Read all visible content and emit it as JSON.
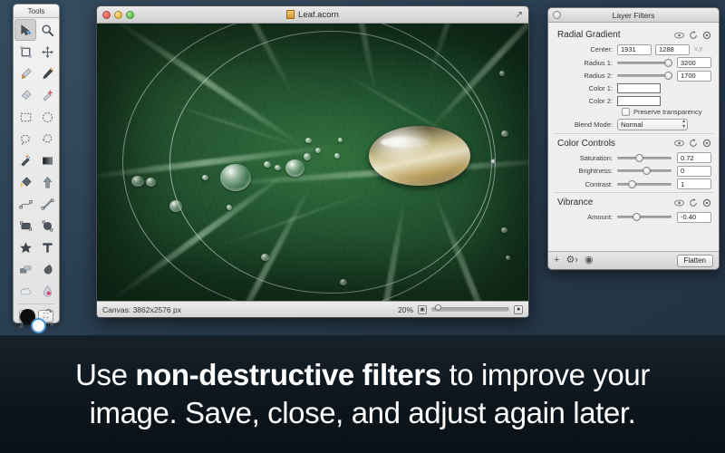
{
  "tools_palette": {
    "title": "Tools",
    "tools": [
      {
        "name": "move-select-tool",
        "selected": true
      },
      {
        "name": "zoom-tool",
        "selected": false
      },
      {
        "name": "crop-tool",
        "selected": false
      },
      {
        "name": "pan-tool",
        "selected": false
      },
      {
        "name": "paintbrush-tool",
        "selected": false
      },
      {
        "name": "pencil-tool",
        "selected": false
      },
      {
        "name": "eraser-tool",
        "selected": false
      },
      {
        "name": "magic-wand-tool",
        "selected": false
      },
      {
        "name": "rectangular-marquee-tool",
        "selected": false
      },
      {
        "name": "elliptical-marquee-tool",
        "selected": false
      },
      {
        "name": "lasso-tool",
        "selected": false
      },
      {
        "name": "polygon-lasso-tool",
        "selected": false
      },
      {
        "name": "clone-stamp-tool",
        "selected": false
      },
      {
        "name": "gradient-tool",
        "selected": false
      },
      {
        "name": "paint-bucket-tool",
        "selected": false
      },
      {
        "name": "arrow-shape-tool",
        "selected": false
      },
      {
        "name": "bezier-pen-tool",
        "selected": false
      },
      {
        "name": "line-tool",
        "selected": false
      },
      {
        "name": "rectangle-shape-tool",
        "selected": false
      },
      {
        "name": "ellipse-shape-tool",
        "selected": false
      },
      {
        "name": "star-shape-tool",
        "selected": false
      },
      {
        "name": "text-tool",
        "selected": false
      },
      {
        "name": "burn-tool",
        "selected": false
      },
      {
        "name": "smudge-tool",
        "selected": false
      },
      {
        "name": "cloud-tool",
        "selected": false
      },
      {
        "name": "blood-drop-tool",
        "selected": false
      }
    ],
    "foreground_color": "#0d0d0d",
    "background_color": "#fbfbfb",
    "mode_buttons": [
      "mask-mode",
      "fullscreen-mode"
    ]
  },
  "image_window": {
    "title": "Leaf.acorn",
    "traffic_lights": [
      "close-button",
      "minimize-button",
      "zoom-button"
    ],
    "status": {
      "canvas_label": "Canvas:",
      "canvas_size": "3862x2576 px",
      "zoom_level": "20%"
    }
  },
  "filters_panel": {
    "window_title": "Layer Filters",
    "sections": [
      {
        "title": "Radial Gradient",
        "header_icons": [
          "eye-icon",
          "reset-icon",
          "gear-icon"
        ],
        "rows": [
          {
            "type": "pair",
            "label": "Center:",
            "value_a": "1931",
            "value_b": "1288",
            "suffix": "x,y"
          },
          {
            "type": "slider",
            "label": "Radius 1:",
            "value": "3200",
            "knob_pct": 95
          },
          {
            "type": "slider",
            "label": "Radius 2:",
            "value": "1700",
            "knob_pct": 95
          },
          {
            "type": "swatch",
            "label": "Color 1:",
            "style": "solid-black"
          },
          {
            "type": "swatch",
            "label": "Color 2:",
            "style": "black-to-white"
          },
          {
            "type": "checkbox",
            "label": "Preserve transparency",
            "checked": false
          },
          {
            "type": "popup",
            "label": "Blend Mode:",
            "value": "Normal"
          }
        ]
      },
      {
        "title": "Color Controls",
        "header_icons": [
          "eye-icon",
          "reset-icon",
          "gear-icon"
        ],
        "rows": [
          {
            "type": "slider",
            "label": "Saturation:",
            "value": "0.72",
            "knob_pct": 36
          },
          {
            "type": "slider",
            "label": "Brightness:",
            "value": "0",
            "knob_pct": 50
          },
          {
            "type": "slider",
            "label": "Contrast:",
            "value": "1",
            "knob_pct": 23
          }
        ]
      },
      {
        "title": "Vibrance",
        "header_icons": [
          "eye-icon",
          "reset-icon",
          "gear-icon"
        ],
        "rows": [
          {
            "type": "slider",
            "label": "Amount:",
            "value": "-0.40",
            "knob_pct": 31
          }
        ]
      }
    ],
    "footer": {
      "icons": [
        "add-filter-icon",
        "action-gear-icon",
        "preview-icon"
      ],
      "flatten_label": "Flatten"
    }
  },
  "caption": {
    "line1_pre": "Use ",
    "line1_bold": "non-destructive filters",
    "line1_post": " to improve your",
    "line2": "image. Save, close, and adjust again later."
  },
  "colors": {
    "desktop": "#2b4155",
    "panel_bg": "#efefef",
    "caption_bg": "#0d161d",
    "accent_blue": "#4b94d6"
  }
}
